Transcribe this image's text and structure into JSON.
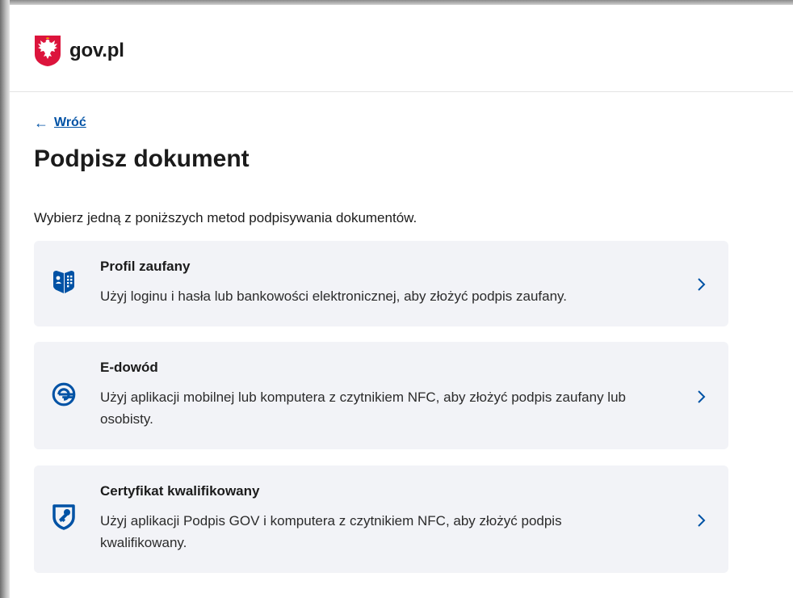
{
  "header": {
    "brand": "gov.pl"
  },
  "nav": {
    "back_arrow": "←",
    "back_label": "Wróć"
  },
  "page": {
    "title": "Podpisz dokument",
    "intro": "Wybierz jedną z poniższych metod podpisywania dokumentów."
  },
  "methods": [
    {
      "icon": "profil-zaufany-icon",
      "title": "Profil zaufany",
      "description": "Użyj loginu i hasła lub bankowości elektronicznej, aby złożyć podpis zaufany."
    },
    {
      "icon": "e-dowod-icon",
      "title": "E-dowód",
      "description": "Użyj aplikacji mobilnej lub komputera z czytnikiem NFC, aby złożyć podpis zaufany lub osobisty."
    },
    {
      "icon": "certificate-icon",
      "title": "Certyfikat kwalifikowany",
      "description": "Użyj aplikacji Podpis GOV i komputera z czytnikiem NFC, aby złożyć podpis kwalifikowany."
    }
  ],
  "colors": {
    "accent": "#0052a5",
    "card_bg": "#f2f3f7",
    "emblem_red": "#dc143c"
  }
}
